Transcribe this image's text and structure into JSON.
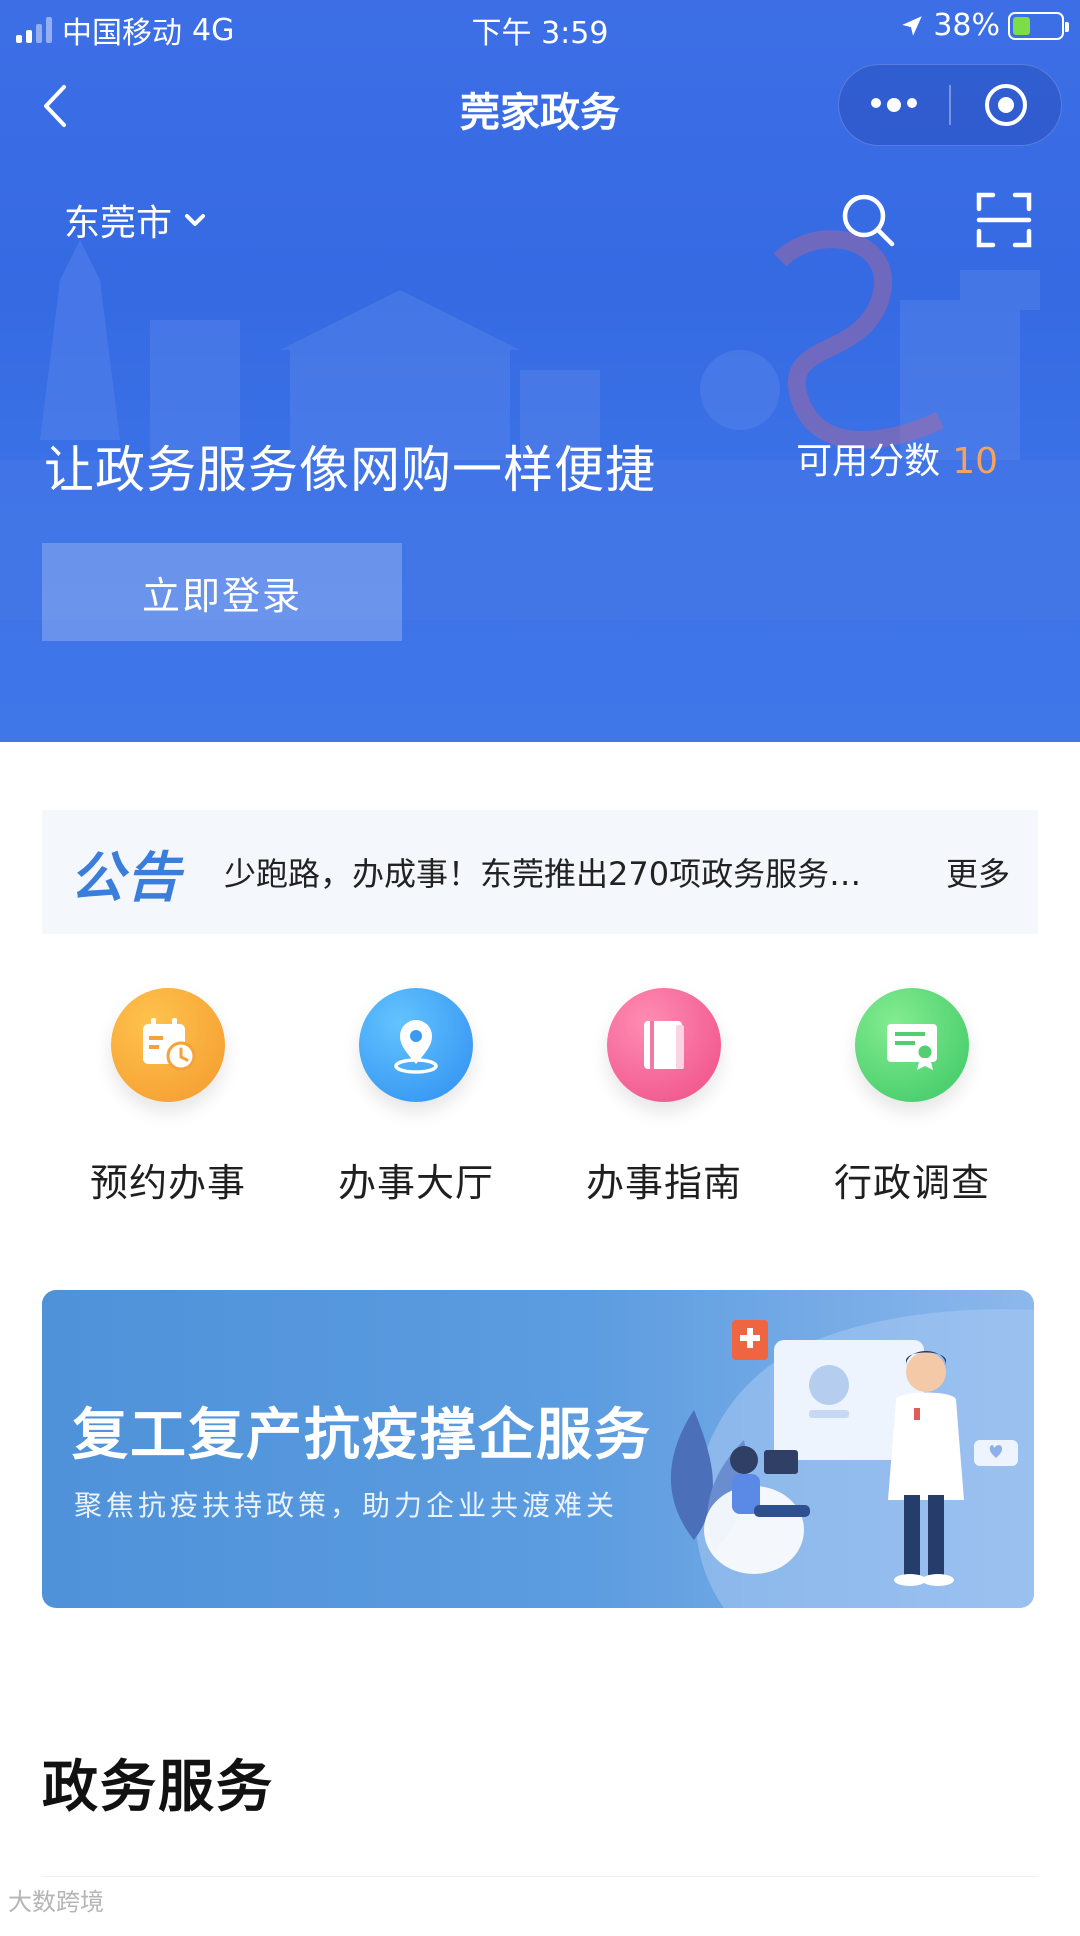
{
  "status_bar": {
    "carrier": "中国移动",
    "network": "4G",
    "time": "下午 3:59",
    "battery": "38%",
    "battery_level": 0.38
  },
  "nav": {
    "title": "莞家政务",
    "back_icon": "back-chevron-icon",
    "more_icon": "more-dots-icon",
    "close_icon": "target-circle-icon"
  },
  "toolbar": {
    "city": "东莞市",
    "search_icon": "search-icon",
    "scan_icon": "scan-icon"
  },
  "hero": {
    "slogan": "让政务服务像网购一样便捷",
    "points_label": "可用分数",
    "points_value": "10",
    "login_label": "立即登录"
  },
  "notice": {
    "badge": "公告",
    "text": "少跑路，办成事！东莞推出270项政务服务…",
    "more": "更多"
  },
  "services": [
    {
      "label": "预约办事",
      "icon": "calendar-clock-icon",
      "color": "#f7a23b"
    },
    {
      "label": "办事大厅",
      "icon": "location-pin-icon",
      "color": "#3fa2f2"
    },
    {
      "label": "办事指南",
      "icon": "book-icon",
      "color": "#f2679a"
    },
    {
      "label": "行政调查",
      "icon": "certificate-icon",
      "color": "#5ed37a"
    }
  ],
  "banner": {
    "title": "复工复产抗疫撑企服务",
    "subtitle": "聚焦抗疫扶持政策，助力企业共渡难关"
  },
  "section": {
    "title": "政务服务"
  },
  "watermark": "大数跨境",
  "colors": {
    "brand_blue": "#3568e3",
    "points_orange": "#f5a25d",
    "notice_blue": "#3b7ddb"
  }
}
